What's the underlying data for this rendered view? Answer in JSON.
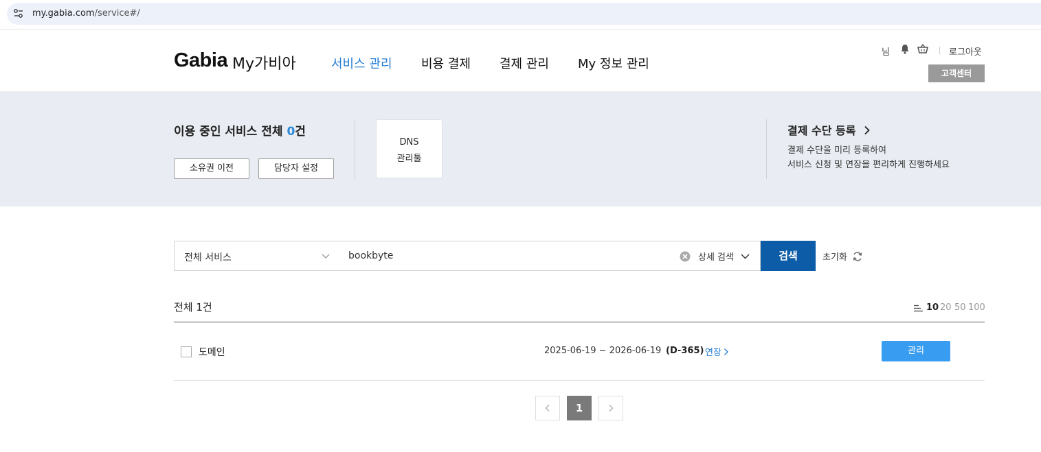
{
  "browser": {
    "url_host": "my.gabia.com",
    "url_path": "/service#/"
  },
  "header": {
    "logo": "Gabia",
    "logo_sub": "My가비아",
    "nav": [
      {
        "label": "서비스 관리",
        "active": true
      },
      {
        "label": "비용 결제",
        "active": false
      },
      {
        "label": "결제 관리",
        "active": false
      },
      {
        "label": "My 정보 관리",
        "active": false
      }
    ],
    "user_suffix": "님",
    "bell_icon": "bell-icon",
    "cart_icon": "cart-icon",
    "logout": "로그아웃",
    "customer_center": "고객센터"
  },
  "summary": {
    "title_prefix": "이용 중인 서비스 전체 ",
    "count": "0",
    "title_suffix": "건",
    "transfer_button": "소유권 이전",
    "manager_button": "담당자 설정",
    "dns_line1": "DNS",
    "dns_line2": "관리툴",
    "payment_title": "결제 수단 등록",
    "payment_desc1": "결제 수단을 미리 등록하여",
    "payment_desc2": "서비스 신청 및 연장을 편리하게 진행하세요"
  },
  "search": {
    "category": "전체 서비스",
    "query": "bookbyte",
    "advanced": "상세 검색",
    "submit": "검색",
    "reset": "초기화"
  },
  "results": {
    "total": "전체 1건",
    "per_page": [
      "10",
      "20",
      "50",
      "100"
    ],
    "per_page_selected": "10",
    "rows": [
      {
        "name": "도메인",
        "period": "2025-06-19 ~ 2026-06-19",
        "dday": "(D-365)",
        "renew": "연장",
        "manage": "관리"
      }
    ]
  },
  "pagination": {
    "current": "1"
  },
  "colors": {
    "accent": "#2a7fd4",
    "search_button": "#0c5ca8",
    "manage_button": "#389df0",
    "band_bg": "#e9edf3"
  }
}
